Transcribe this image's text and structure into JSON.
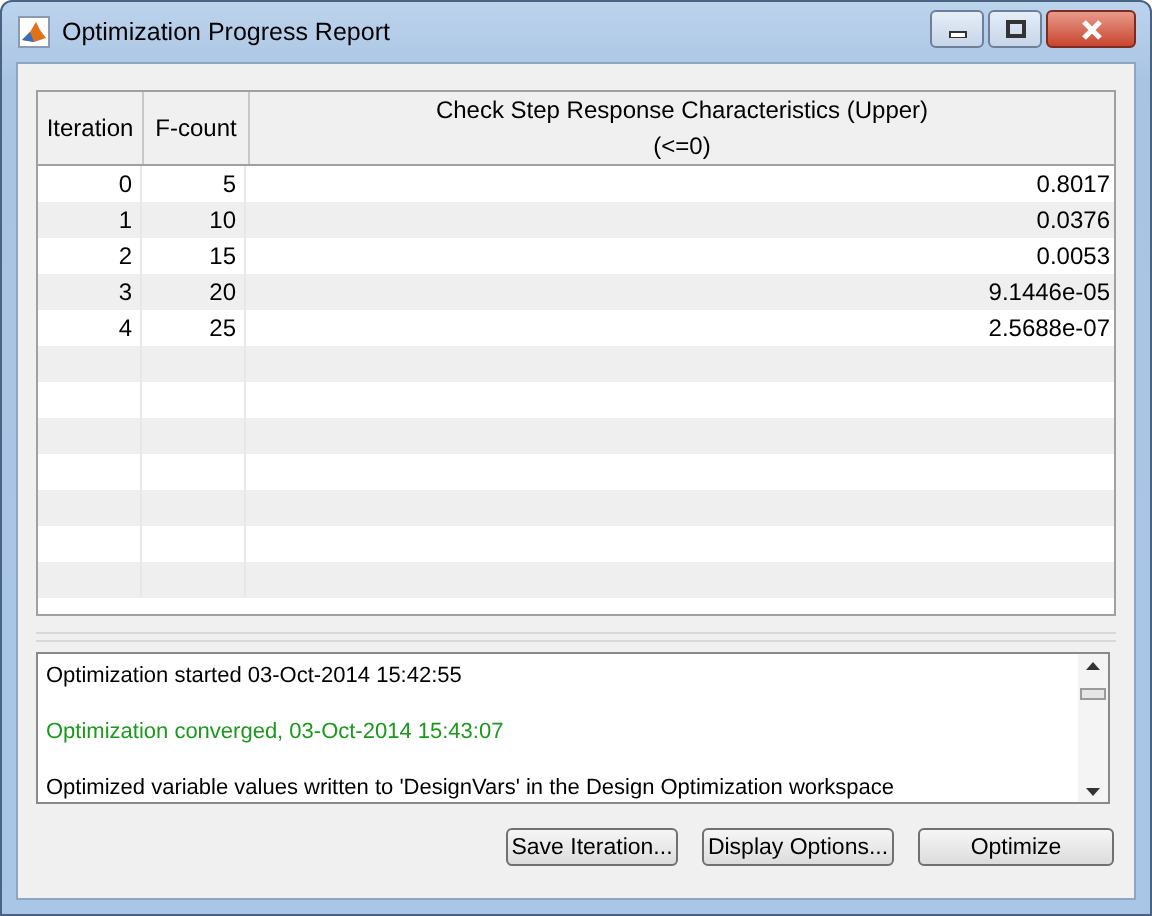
{
  "window": {
    "title": "Optimization Progress Report"
  },
  "table": {
    "columns": [
      "Iteration",
      "F-count",
      "Check Step Response  Characteristics (Upper)\n(<=0)"
    ],
    "rows": [
      {
        "cells": [
          "0",
          "5",
          "0.8017"
        ]
      },
      {
        "cells": [
          "1",
          "10",
          "0.0376"
        ]
      },
      {
        "cells": [
          "2",
          "15",
          "0.0053"
        ]
      },
      {
        "cells": [
          "3",
          "20",
          "9.1446e-05"
        ]
      },
      {
        "cells": [
          "4",
          "25",
          "2.5688e-07"
        ]
      }
    ]
  },
  "log": [
    {
      "text": "Optimization started 03-Oct-2014 15:42:55",
      "color": "#000000"
    },
    {
      "text": "Optimization converged, 03-Oct-2014 15:43:07",
      "color": "#1a9a1a"
    },
    {
      "text": "Optimized variable values written to 'DesignVars' in the Design Optimization workspace",
      "color": "#000000"
    }
  ],
  "buttons": [
    "Save Iteration...",
    "Display Options...",
    "Optimize"
  ]
}
